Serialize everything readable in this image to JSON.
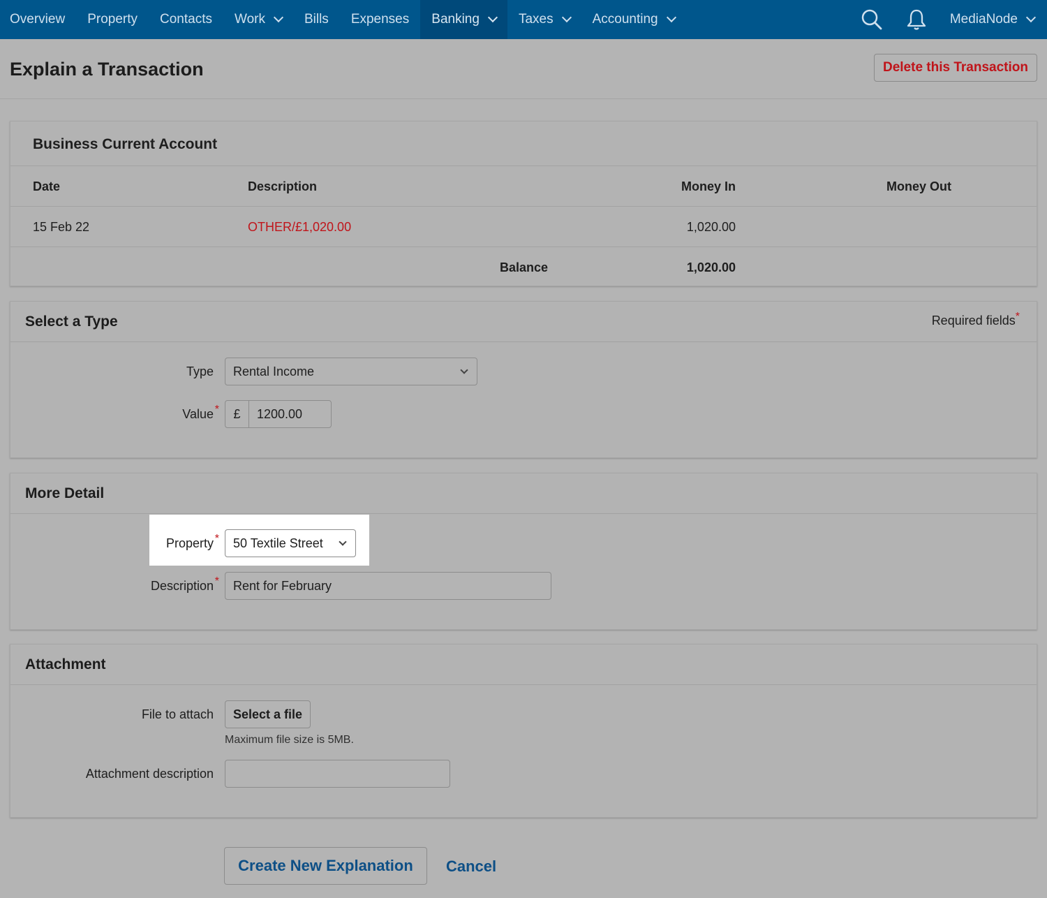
{
  "nav": {
    "items": [
      {
        "label": "Overview",
        "dropdown": false,
        "active": false
      },
      {
        "label": "Property",
        "dropdown": false,
        "active": false
      },
      {
        "label": "Contacts",
        "dropdown": false,
        "active": false
      },
      {
        "label": "Work",
        "dropdown": true,
        "active": false
      },
      {
        "label": "Bills",
        "dropdown": false,
        "active": false
      },
      {
        "label": "Expenses",
        "dropdown": false,
        "active": false
      },
      {
        "label": "Banking",
        "dropdown": true,
        "active": true
      },
      {
        "label": "Taxes",
        "dropdown": true,
        "active": false
      },
      {
        "label": "Accounting",
        "dropdown": true,
        "active": false
      }
    ],
    "user": "MediaNode",
    "icons": [
      "search-icon",
      "bell-icon",
      "chevron-down-icon"
    ]
  },
  "header": {
    "title": "Explain a Transaction",
    "delete_label": "Delete this Transaction"
  },
  "account": {
    "title": "Business Current Account",
    "columns": {
      "date": "Date",
      "description": "Description",
      "money_in": "Money In",
      "money_out": "Money Out"
    },
    "row": {
      "date": "15 Feb 22",
      "description": "OTHER/£1,020.00",
      "money_in": "1,020.00",
      "money_out": ""
    },
    "balance_label": "Balance",
    "balance_value": "1,020.00"
  },
  "type_section": {
    "title": "Select a Type",
    "required_note": "Required fields",
    "required_star": "*",
    "type_label": "Type",
    "type_value": "Rental Income",
    "value_label": "Value",
    "currency": "£",
    "value": "1200.00"
  },
  "detail_section": {
    "title": "More Detail",
    "property_label": "Property",
    "property_value": "50 Textile Street",
    "description_label": "Description",
    "description_value": "Rent for February"
  },
  "attachment_section": {
    "title": "Attachment",
    "file_label": "File to attach",
    "file_button": "Select a file",
    "hint": "Maximum file size is 5MB.",
    "desc_label": "Attachment description",
    "desc_value": ""
  },
  "actions": {
    "create_label": "Create New Explanation",
    "cancel_label": "Cancel"
  },
  "colors": {
    "nav_bg": "#00568c",
    "accent_red": "#c0141a",
    "link_blue": "#0d4f86"
  }
}
